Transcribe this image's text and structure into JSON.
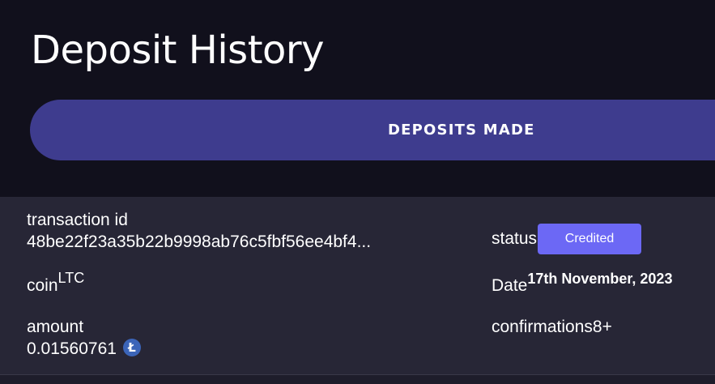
{
  "header": {
    "title": "Deposit History"
  },
  "tabs": {
    "deposits_made_label": "DEPOSITS MADE"
  },
  "record": {
    "transaction_id_label": "transaction id",
    "transaction_id_value": "48be22f23a35b22b9998ab76c5fbf56ee4bf4...",
    "coin_label": "coin",
    "coin_value": "LTC",
    "amount_label": "amount",
    "amount_value": "0.01560761",
    "amount_icon": "litecoin-icon",
    "amount_icon_glyph": "Ł",
    "status_label": "status",
    "status_value": "Credited",
    "date_label": "Date",
    "date_value": "17th November, 2023",
    "confirmations_label": "confirmations",
    "confirmations_value": "8+"
  },
  "colors": {
    "background": "#11101c",
    "tab_active": "#3e3c8e",
    "card": "#272636",
    "status_badge": "#6c68f5",
    "litecoin": "#3b64b8"
  }
}
